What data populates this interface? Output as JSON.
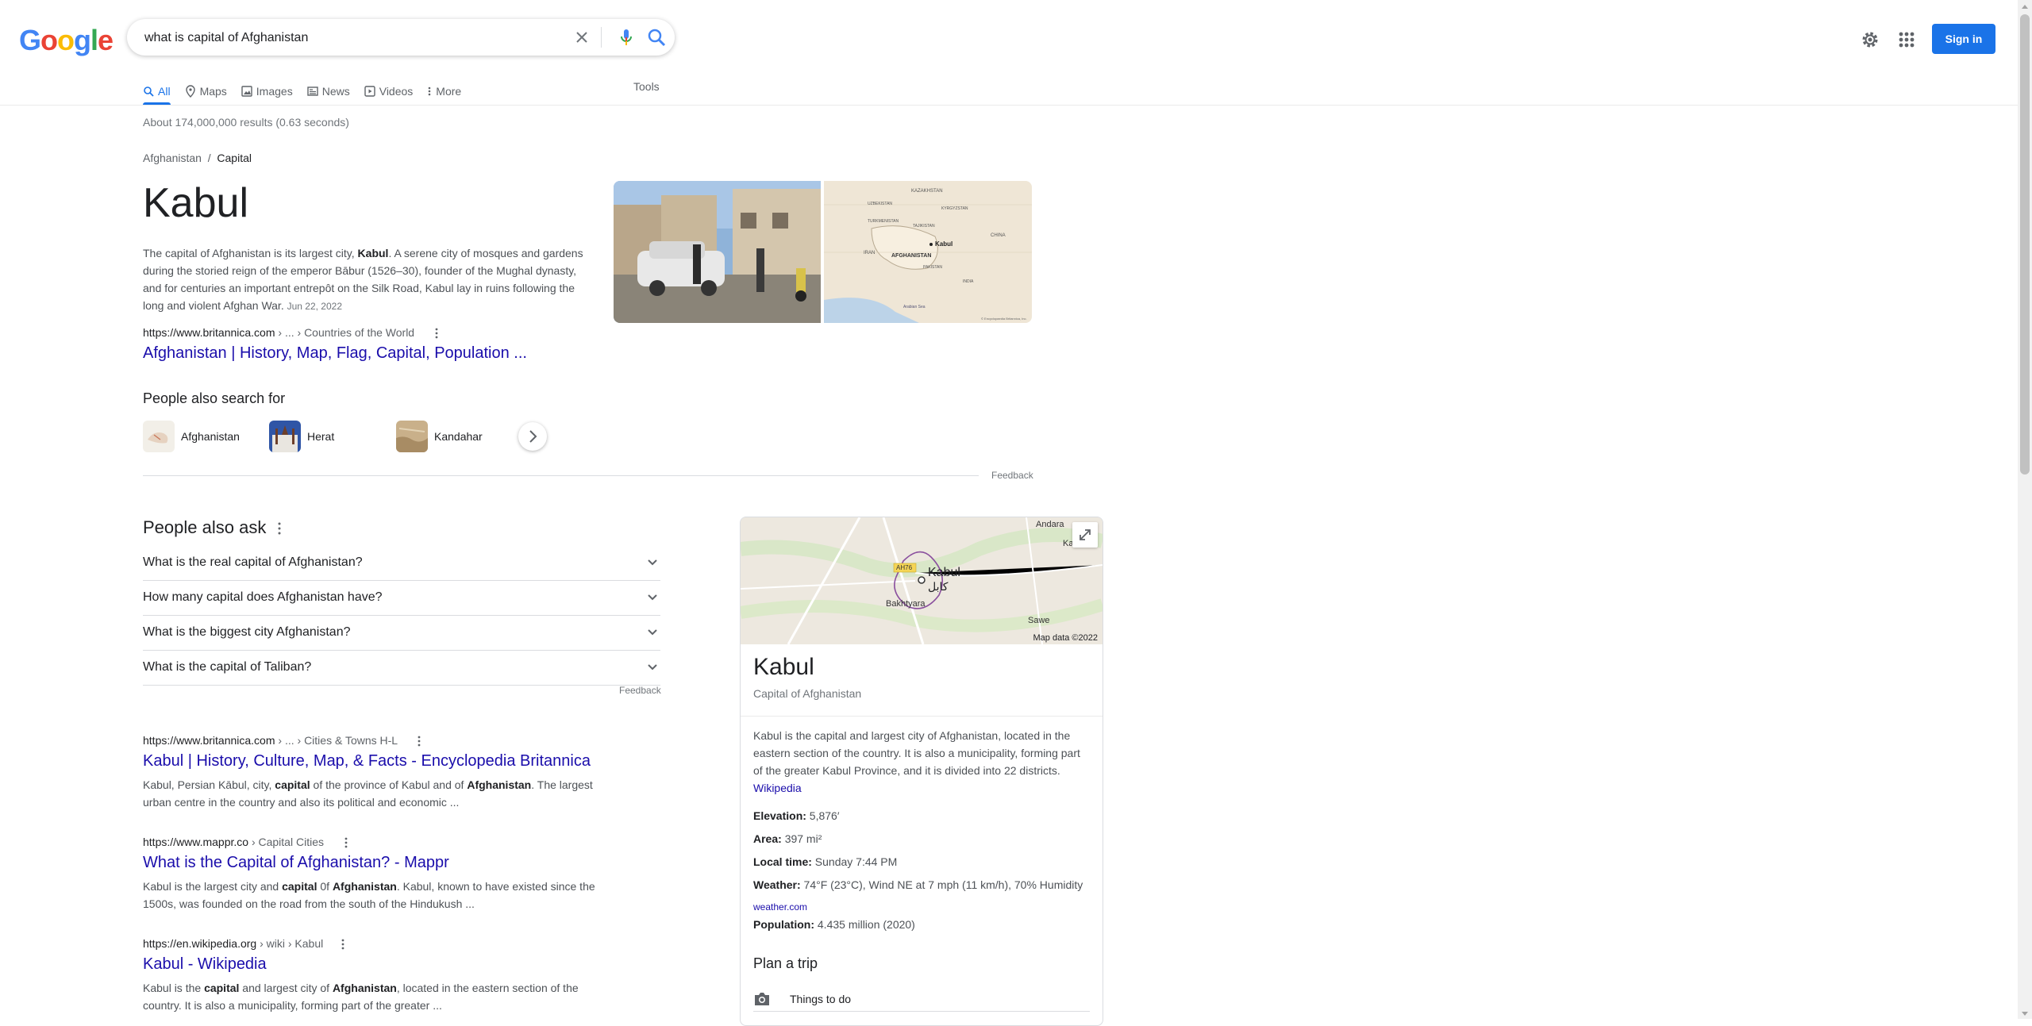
{
  "header": {
    "logo_letters": [
      "G",
      "o",
      "o",
      "g",
      "l",
      "e"
    ],
    "logo_colors": [
      "#4285F4",
      "#EA4335",
      "#FBBC05",
      "#4285F4",
      "#34A853",
      "#EA4335"
    ],
    "query": "what is capital of Afghanistan",
    "signin_label": "Sign in"
  },
  "tabs": [
    {
      "label": "All",
      "icon": "search-icon",
      "active": true
    },
    {
      "label": "Maps",
      "icon": "map-pin-icon"
    },
    {
      "label": "Images",
      "icon": "image-icon"
    },
    {
      "label": "News",
      "icon": "news-icon"
    },
    {
      "label": "Videos",
      "icon": "video-icon"
    },
    {
      "label": "More",
      "icon": "more-vert-icon"
    }
  ],
  "tools_label": "Tools",
  "result_stats": "About 174,000,000 results (0.63 seconds)",
  "featured": {
    "breadcrumb_parent": "Afghanistan",
    "breadcrumb_sep": "/",
    "breadcrumb_current": "Capital",
    "answer": "Kabul",
    "snippet_pre": "The capital of Afghanistan is its largest city, ",
    "snippet_bold": "Kabul",
    "snippet_post": ". A serene city of mosques and gardens during the storied reign of the emperor Bābur (1526–30), founder of the Mughal dynasty, and for centuries an important entrepôt on the Silk Road, Kabul lay in ruins following the long and violent Afghan War.",
    "date": "Jun 22, 2022",
    "url_domain": "https://www.britannica.com",
    "url_path": " › ... › Countries of the World",
    "link_title": "Afghanistan | History, Map, Flag, Capital, Population ..."
  },
  "map_thumb_labels": {
    "kazakhstan": "KAZAKHSTAN",
    "uzbekistan": "UZBEKISTAN",
    "kyrgyzstan": "KYRGYZSTAN",
    "turkmenistan": "TURKMENISTAN",
    "tajikistan": "TAJIKISTAN",
    "china": "CHINA",
    "iran": "IRAN",
    "kabul": "Kabul",
    "afghanistan": "AFGHANISTAN",
    "pakistan": "PAKISTAN",
    "india": "INDIA",
    "arabian_sea": "Arabian Sea",
    "credit": "© Encyclopaedia Britannica, Inc."
  },
  "pasf": {
    "title": "People also search for",
    "items": [
      {
        "label": "Afghanistan"
      },
      {
        "label": "Herat"
      },
      {
        "label": "Kandahar"
      }
    ]
  },
  "feedback_label": "Feedback",
  "paa": {
    "title": "People also ask",
    "questions": [
      "What is the real capital of Afghanistan?",
      "How many capital does Afghanistan have?",
      "What is the biggest city Afghanistan?",
      "What is the capital of Taliban?"
    ]
  },
  "results": [
    {
      "domain": "https://www.britannica.com",
      "path": " › ... › Cities & Towns H-L",
      "title": "Kabul | History, Culture, Map, & Facts - Encyclopedia Britannica",
      "snippet_parts": [
        {
          "t": "Kabul, Persian Kābul, city, "
        },
        {
          "t": "capital",
          "b": true
        },
        {
          "t": " of the province of Kabul and of "
        },
        {
          "t": "Afghanistan",
          "b": true
        },
        {
          "t": ". The largest urban centre in the country and also its political and economic ..."
        }
      ]
    },
    {
      "domain": "https://www.mappr.co",
      "path": " › Capital Cities",
      "title": "What is the Capital of Afghanistan? - Mappr",
      "snippet_parts": [
        {
          "t": "Kabul is the largest city and "
        },
        {
          "t": "capital",
          "b": true
        },
        {
          "t": " 0f "
        },
        {
          "t": "Afghanistan",
          "b": true
        },
        {
          "t": ". Kabul, known to have existed since the 1500s, was founded on the road from the south of the Hindukush ..."
        }
      ]
    },
    {
      "domain": "https://en.wikipedia.org",
      "path": " › wiki › Kabul",
      "title": "Kabul - Wikipedia",
      "snippet_parts": [
        {
          "t": "Kabul is the "
        },
        {
          "t": "capital",
          "b": true
        },
        {
          "t": " and largest city of "
        },
        {
          "t": "Afghanistan",
          "b": true
        },
        {
          "t": ", located in the eastern section of the country. It is also a municipality, forming part of the greater ..."
        }
      ]
    }
  ],
  "kp": {
    "map_labels": {
      "andara": "Andara",
      "kabul": "Kabul",
      "kabul_native": "کابل",
      "bakhtyara": "Bakhtyara",
      "sawe": "Sawe",
      "road": "AH76",
      "ka": "Ka"
    },
    "map_data": "Map data ©2022",
    "title": "Kabul",
    "subtitle": "Capital of Afghanistan",
    "description": "Kabul is the capital and largest city of Afghanistan, located in the eastern section of the country. It is also a municipality, forming part of the greater Kabul Province, and it is divided into 22 districts.",
    "wiki_label": "Wikipedia",
    "facts": [
      {
        "key": "Elevation:",
        "value": "5,876′"
      },
      {
        "key": "Area:",
        "value": "397 mi²"
      },
      {
        "key": "Local time:",
        "value": "Sunday 7:44 PM"
      },
      {
        "key": "Weather:",
        "value": "74°F (23°C), Wind NE at 7 mph (11 km/h), 70% Humidity"
      }
    ],
    "weather_source": "weather.com",
    "population_key": "Population:",
    "population_value": "4.435 million (2020)",
    "plan_title": "Plan a trip",
    "things_label": "Things to do"
  }
}
